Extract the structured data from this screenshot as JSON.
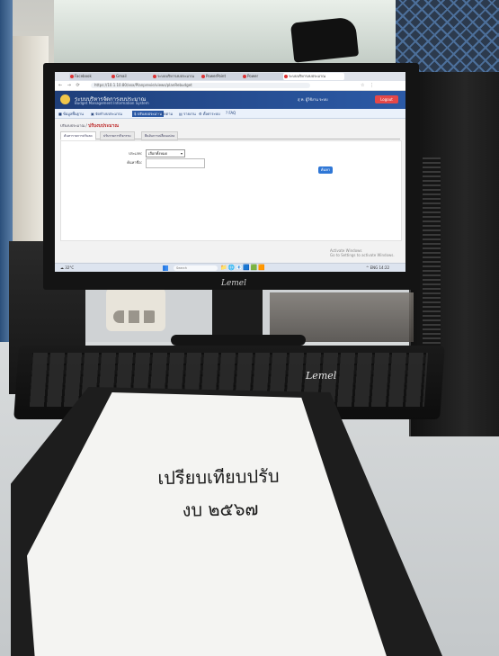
{
  "photo": {
    "paper_text": {
      "line1": "เปรียบเทียบปรับ",
      "line2": "งบ ๒๕๖๗"
    },
    "monitor_brand": "Lemel",
    "keyboard_brand": "Lemel"
  },
  "browser": {
    "tabs": [
      {
        "label": "Facebook"
      },
      {
        "label": "Gmail"
      },
      {
        "label": "ระบบบริหารงบประมาณ"
      },
      {
        "label": "PowerPoint"
      },
      {
        "label": "Power"
      },
      {
        "label": "ระบบบริหารงบประมาณ"
      }
    ],
    "url": "https://10.1.10.80/xxx/Planprevie/views/planRebudget",
    "nav_glyphs": "← → ⟳",
    "toolbar_glyphs": "☆ ⋮"
  },
  "app": {
    "title": "ระบบบริหารจัดการงบประมาณ",
    "subtitle": "Budget Management Information System",
    "user": "สุ ท. ผู้ใช้งาน ระบบ",
    "logout": "Logout",
    "menu": [
      {
        "label": "■ ข้อมูลพื้นฐาน"
      },
      {
        "label": "▣ จัดทำงบประมาณ"
      },
      {
        "label": "$ ปรับงบประมาณ",
        "active": true
      },
      {
        "label": "Q ติดตาม"
      },
      {
        "label": "▤ รายงาน"
      },
      {
        "label": "⚙ ตั้งค่าระบบ"
      },
      {
        "label": "? FAQ"
      }
    ],
    "breadcrumb_prefix": "ปรับงบประมาณ /",
    "breadcrumb_current": "ปรับงบประมาณ",
    "subtabs": [
      {
        "label": "ค้นหารายการปรับลด",
        "active": true
      },
      {
        "label": "ปรับรายการกิจกรรม"
      },
      {
        "label": "ยืนยันการเปลี่ยนแปลง"
      }
    ],
    "form": {
      "type_label": "ประเภท:",
      "type_value": "เลือกทั้งหมด",
      "search_label": "ค้นหาชื่อ:",
      "search_placeholder": "",
      "search_button": "ค้นหา"
    },
    "activate_windows": [
      "Activate Windows",
      "Go to Settings to activate Windows."
    ]
  },
  "taskbar": {
    "weather": "☁ 32°C",
    "search": "Search",
    "apps": "📁🌐📧🟦🟩🟧",
    "tray": "^ ENG 14:22"
  }
}
